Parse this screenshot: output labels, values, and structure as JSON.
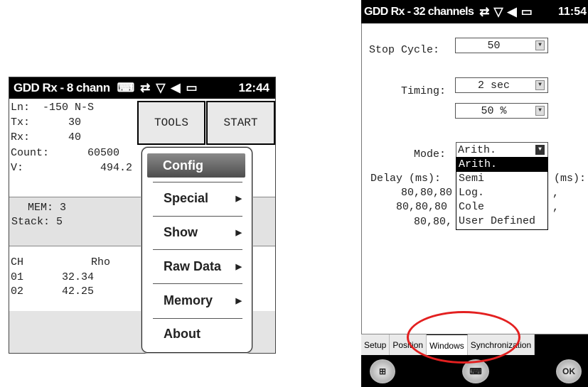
{
  "left": {
    "statusbar": {
      "title": "GDD Rx - 8 chann",
      "time": "12:44"
    },
    "fields": [
      {
        "name": "Ln:",
        "value": "-150 N-S"
      },
      {
        "name": "Tx:",
        "value": "30"
      },
      {
        "name": "Rx:",
        "value": "40"
      },
      {
        "name": "Count:",
        "value": "60500"
      },
      {
        "name": "V:",
        "value": "494.2"
      }
    ],
    "buttons": {
      "tools": "TOOLS",
      "start": "START"
    },
    "mem": {
      "mem": "MEM: 3",
      "stack": "Stack: 5"
    },
    "table": {
      "headers": [
        "CH",
        "Rho"
      ],
      "rows": [
        [
          "01",
          "32.34"
        ],
        [
          "02",
          "42.25"
        ]
      ]
    },
    "menu": [
      {
        "label": "Config",
        "selected": true,
        "submenu": false
      },
      {
        "label": "Special",
        "submenu": true
      },
      {
        "label": "Show",
        "submenu": true
      },
      {
        "label": "Raw Data",
        "submenu": true
      },
      {
        "label": "Memory",
        "submenu": true
      },
      {
        "label": "About",
        "submenu": false
      }
    ]
  },
  "right": {
    "statusbar": {
      "title": "GDD Rx - 32 channels",
      "time": "11:54"
    },
    "stop_cycle": {
      "label": "Stop Cycle:",
      "value": "50"
    },
    "timing": {
      "label": "Timing:",
      "value": "2 sec",
      "percent": "50 %"
    },
    "mode": {
      "label": "Mode:",
      "value": "Arith.",
      "options": [
        "Arith.",
        "Semi",
        "Log.",
        "Cole",
        "User Defined"
      ]
    },
    "delay": {
      "label": "Delay (ms):",
      "label2": "(ms):",
      "rows": [
        "80,80,80",
        "80,80,80",
        "80,80,"
      ],
      "suffix": ","
    },
    "tabs": [
      "Setup",
      "Position",
      "Windows",
      "Synchronization"
    ],
    "active_tab": "Windows",
    "softkeys": {
      "ok": "OK"
    }
  },
  "colors": {
    "highlight_circle": "#e32020",
    "statusbar": "#000000"
  }
}
